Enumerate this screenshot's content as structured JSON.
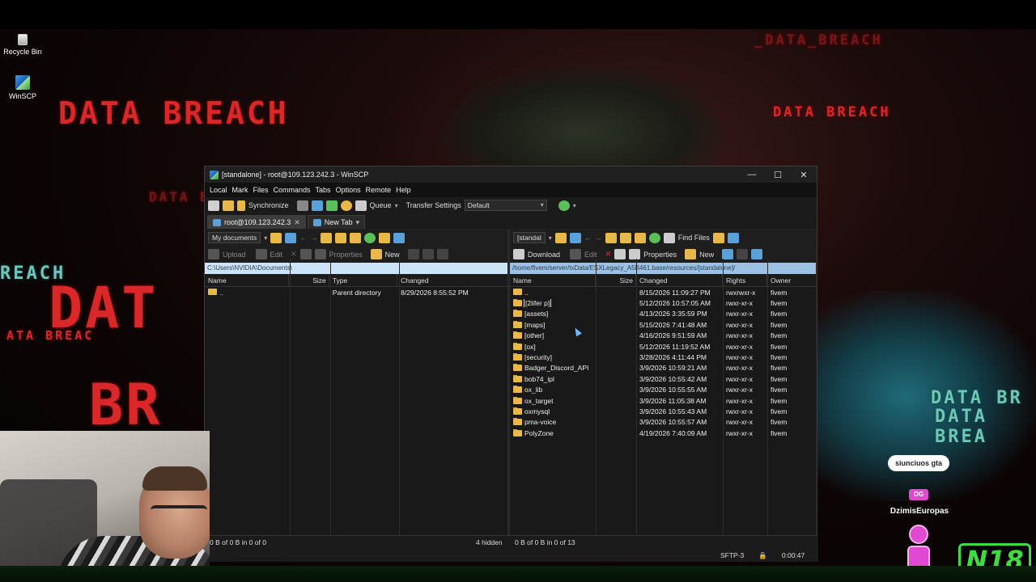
{
  "desktop": {
    "icons": [
      {
        "label": "Recycle Bin",
        "icon": "recycle-bin-icon"
      },
      {
        "label": "WinSCP",
        "icon": "winscp-icon"
      }
    ],
    "wallpaper_text": "DATA BREACH",
    "wallpaper_fragments": [
      "DATA BREACH",
      "DATA B",
      "REACH",
      "DAT",
      "ATA BREAC",
      "BR",
      "DATA BR",
      "DATA BREA",
      "_DATA_BREACH"
    ]
  },
  "window": {
    "title": "[standalone] - root@109.123.242.3 - WinSCP",
    "controls": {
      "minimize": "—",
      "maximize": "☐",
      "close": "✕"
    },
    "menu": [
      "Local",
      "Mark",
      "Files",
      "Commands",
      "Tabs",
      "Options",
      "Remote",
      "Help"
    ],
    "toolbar": {
      "synchronize": "Synchronize",
      "queue": "Queue",
      "transfer_settings_label": "Transfer Settings",
      "transfer_settings_value": "Default"
    },
    "tabs": [
      {
        "label": "root@109.123.242.3",
        "active": true,
        "closable": "✕"
      },
      {
        "label": "New Tab",
        "active": false
      }
    ]
  },
  "left_pane": {
    "location": "My documents",
    "toolbar2": {
      "upload": "Upload",
      "edit": "Edit",
      "properties": "Properties",
      "new": "New"
    },
    "path": "C:\\Users\\NVIDIA\\Documents\\",
    "columns": [
      "Name",
      "Size",
      "Type",
      "Changed"
    ],
    "rows": [
      {
        "name": "..",
        "size": "",
        "type": "Parent directory",
        "changed": "8/29/2026 8:55:52 PM"
      }
    ],
    "status": "0 B of 0 B in 0 of 0",
    "hidden": "4 hidden"
  },
  "right_pane": {
    "location": "[standal",
    "find_files": "Find Files",
    "toolbar2": {
      "download": "Download",
      "edit": "Edit",
      "properties": "Properties",
      "new": "New"
    },
    "path": "/home/fivem/server/txData/ESXLegacy_A5B461.base/resources/[standalone]/",
    "columns": [
      "Name",
      "Size",
      "Changed",
      "Rights",
      "Owner"
    ],
    "rows": [
      {
        "name": "..",
        "changed": "8/15/2026 11:09:27 PM",
        "rights": "rwxrwxr-x",
        "owner": "fivem",
        "updir": true
      },
      {
        "name": "[2lifer p]",
        "changed": "5/12/2026 10:57:05 AM",
        "rights": "rwxr-xr-x",
        "owner": "fivem",
        "selected": true
      },
      {
        "name": "[assets]",
        "changed": "4/13/2026 3:35:59 PM",
        "rights": "rwxr-xr-x",
        "owner": "fivem"
      },
      {
        "name": "[maps]",
        "changed": "5/15/2026 7:41:48 AM",
        "rights": "rwxr-xr-x",
        "owner": "fivem"
      },
      {
        "name": "[other]",
        "changed": "4/16/2026 9:51:59 AM",
        "rights": "rwxr-xr-x",
        "owner": "fivem"
      },
      {
        "name": "[ox]",
        "changed": "5/12/2026 11:19:52 AM",
        "rights": "rwxr-xr-x",
        "owner": "fivem"
      },
      {
        "name": "[security]",
        "changed": "3/28/2026 4:11:44 PM",
        "rights": "rwxr-xr-x",
        "owner": "fivem"
      },
      {
        "name": "Badger_Discord_API",
        "changed": "3/9/2026 10:59:21 AM",
        "rights": "rwxr-xr-x",
        "owner": "fivem"
      },
      {
        "name": "bob74_ipl",
        "changed": "3/9/2026 10:55:42 AM",
        "rights": "rwxr-xr-x",
        "owner": "fivem"
      },
      {
        "name": "ox_lib",
        "changed": "3/9/2026 10:55:55 AM",
        "rights": "rwxr-xr-x",
        "owner": "fivem"
      },
      {
        "name": "ox_target",
        "changed": "3/9/2026 11:05:38 AM",
        "rights": "rwxr-xr-x",
        "owner": "fivem"
      },
      {
        "name": "oxmysql",
        "changed": "3/9/2026 10:55:43 AM",
        "rights": "rwxr-xr-x",
        "owner": "fivem"
      },
      {
        "name": "pma-voice",
        "changed": "3/9/2026 10:55:57 AM",
        "rights": "rwxr-xr-x",
        "owner": "fivem"
      },
      {
        "name": "PolyZone",
        "changed": "4/19/2026 7:40:09 AM",
        "rights": "rwxr-xr-x",
        "owner": "fivem"
      }
    ],
    "status": "0 B of 0 B in 0 of 13"
  },
  "session_status": {
    "protocol": "SFTP-3",
    "time": "0:00:47"
  },
  "overlay": {
    "chat_message": "siunciuos gta",
    "badge": "OG",
    "username": "DzimisEuropas",
    "logo": "N18"
  }
}
